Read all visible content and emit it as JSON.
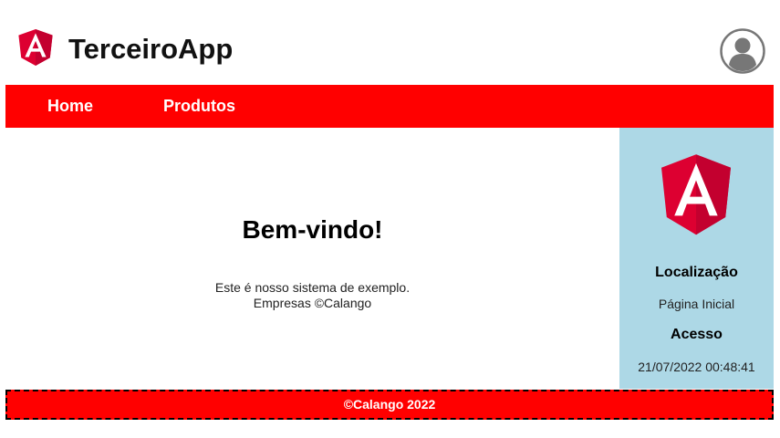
{
  "header": {
    "app_title": "TerceiroApp",
    "logo_icon": "angular-logo-icon",
    "avatar_icon": "user-avatar-icon"
  },
  "nav": {
    "items": [
      {
        "label": "Home"
      },
      {
        "label": "Produtos"
      }
    ]
  },
  "main": {
    "welcome": "Bem-vindo!",
    "description_line1": "Este é nosso sistema de exemplo.",
    "description_line2": "Empresas ©Calango"
  },
  "sidebar": {
    "logo_icon": "angular-logo-icon",
    "location_label": "Localização",
    "location_value": "Página Inicial",
    "access_label": "Acesso",
    "access_value": "21/07/2022 00:48:41"
  },
  "footer": {
    "text": "©Calango 2022"
  },
  "colors": {
    "brand_red": "#ff0000",
    "sidebar_bg": "#add8e6",
    "angular_red": "#dd0031",
    "angular_dark_red": "#c3002f"
  }
}
